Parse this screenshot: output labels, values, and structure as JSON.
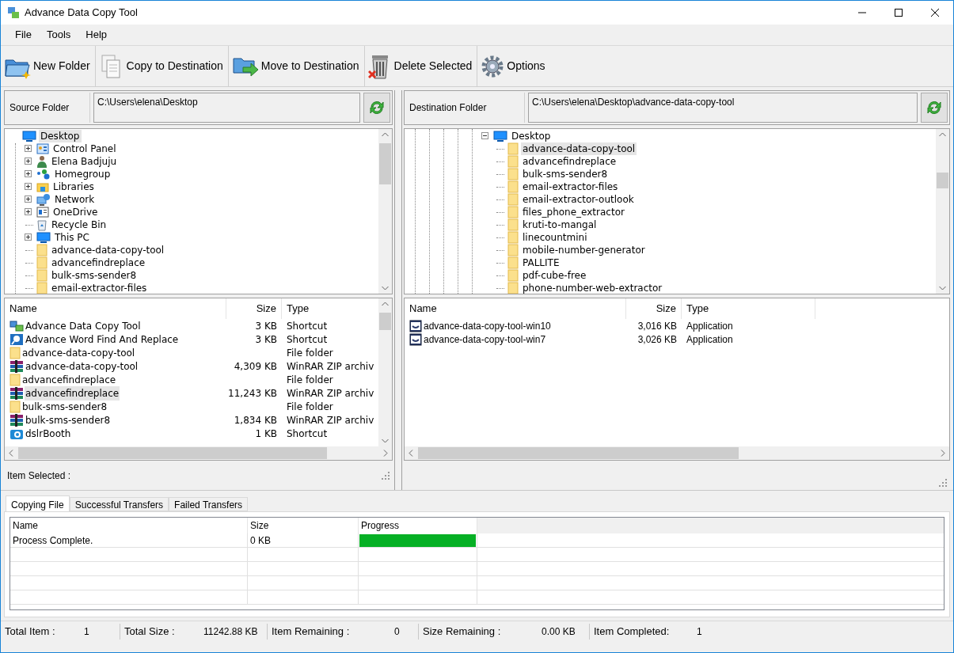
{
  "window": {
    "title": "Advance Data Copy Tool"
  },
  "menu": [
    "File",
    "Tools",
    "Help"
  ],
  "toolbar": [
    {
      "label": "New Folder",
      "kind": "newfolder",
      "disabled": false
    },
    {
      "label": "Copy to Destination",
      "kind": "copy",
      "disabled": false
    },
    {
      "label": "Move to Destination",
      "kind": "move",
      "disabled": false
    },
    {
      "label": "Delete Selected",
      "kind": "delete",
      "disabled": false
    },
    {
      "label": "Options",
      "kind": "gear",
      "disabled": false
    }
  ],
  "source": {
    "label": "Source Folder",
    "path": "C:\\Users\\elena\\Desktop",
    "tree": [
      {
        "label": "Desktop",
        "kind": "desktop",
        "expandable": false,
        "selected": true,
        "children": [
          {
            "label": "Control Panel",
            "kind": "panel",
            "expandable": true,
            "expanded": false,
            "selected": false
          },
          {
            "label": "Elena Badjuju",
            "kind": "user",
            "expandable": true,
            "expanded": false,
            "selected": false
          },
          {
            "label": "Homegroup",
            "kind": "homegroup",
            "expandable": true,
            "expanded": false,
            "selected": false
          },
          {
            "label": "Libraries",
            "kind": "libraries",
            "expandable": true,
            "expanded": false,
            "selected": false
          },
          {
            "label": "Network",
            "kind": "network",
            "expandable": true,
            "expanded": false,
            "selected": false
          },
          {
            "label": "OneDrive",
            "kind": "onedrive",
            "expandable": true,
            "expanded": false,
            "selected": false
          },
          {
            "label": "Recycle Bin",
            "kind": "recycle",
            "expandable": false,
            "selected": false
          },
          {
            "label": "This PC",
            "kind": "desktop",
            "expandable": true,
            "expanded": false,
            "selected": false
          },
          {
            "label": "advance-data-copy-tool",
            "kind": "folder",
            "expandable": false,
            "selected": false
          },
          {
            "label": "advancefindreplace",
            "kind": "folder",
            "expandable": false,
            "selected": false
          },
          {
            "label": "bulk-sms-sender8",
            "kind": "folder",
            "expandable": false,
            "selected": false
          },
          {
            "label": "email-extractor-files",
            "kind": "folder",
            "expandable": false,
            "selected": false
          }
        ]
      }
    ],
    "columns": [
      "Name",
      "Size",
      "Type"
    ],
    "files": [
      {
        "name": "Advance Data Copy Tool",
        "size": "3 KB",
        "type": "Shortcut",
        "kind": "copytool",
        "selected": false
      },
      {
        "name": "Advance Word Find And Replace",
        "size": "3 KB",
        "type": "Shortcut",
        "kind": "wordapp",
        "selected": false
      },
      {
        "name": "advance-data-copy-tool",
        "type": "File folder",
        "kind": "folder",
        "selected": false
      },
      {
        "name": "advance-data-copy-tool",
        "size": "4,309 KB",
        "type": "WinRAR ZIP archiv",
        "kind": "archive",
        "selected": false
      },
      {
        "name": "advancefindreplace",
        "type": "File folder",
        "kind": "folder",
        "selected": false
      },
      {
        "name": "advancefindreplace",
        "size": "11,243 KB",
        "type": "WinRAR ZIP archiv",
        "kind": "archive",
        "selected": true
      },
      {
        "name": "bulk-sms-sender8",
        "type": "File folder",
        "kind": "folder",
        "selected": false
      },
      {
        "name": "bulk-sms-sender8",
        "size": "1,834 KB",
        "type": "WinRAR ZIP archiv",
        "kind": "archive",
        "selected": false
      },
      {
        "name": "dslrBooth",
        "size": "1 KB",
        "type": "Shortcut",
        "kind": "camera",
        "selected": false
      }
    ],
    "status": "Item Selected :"
  },
  "destination": {
    "label": "Destination Folder",
    "path": "C:\\Users\\elena\\Desktop\\advance-data-copy-tool",
    "tree": [
      {
        "label": "Desktop",
        "kind": "desktop",
        "expandable": true,
        "expanded": true,
        "selected": false,
        "children": [
          {
            "label": "advance-data-copy-tool",
            "kind": "folder",
            "expandable": false,
            "selected": true
          },
          {
            "label": "advancefindreplace",
            "kind": "folder",
            "expandable": false,
            "selected": false
          },
          {
            "label": "bulk-sms-sender8",
            "kind": "folder",
            "expandable": false,
            "selected": false
          },
          {
            "label": "email-extractor-files",
            "kind": "folder",
            "expandable": false,
            "selected": false
          },
          {
            "label": "email-extractor-outlook",
            "kind": "folder",
            "expandable": false,
            "selected": false
          },
          {
            "label": "files_phone_extractor",
            "kind": "folder",
            "expandable": false,
            "selected": false
          },
          {
            "label": "kruti-to-mangal",
            "kind": "folder",
            "expandable": false,
            "selected": false
          },
          {
            "label": "linecountmini",
            "kind": "folder",
            "expandable": false,
            "selected": false
          },
          {
            "label": "mobile-number-generator",
            "kind": "folder",
            "expandable": false,
            "selected": false
          },
          {
            "label": "PALLITE",
            "kind": "folder",
            "expandable": false,
            "selected": false
          },
          {
            "label": "pdf-cube-free",
            "kind": "folder",
            "expandable": false,
            "selected": false
          },
          {
            "label": "phone-number-web-extractor",
            "kind": "folder",
            "expandable": false,
            "selected": false
          }
        ]
      }
    ],
    "columns": [
      "Name",
      "Size",
      "Type"
    ],
    "files": [
      {
        "name": "advance-data-copy-tool-win10",
        "size": "3,016 KB",
        "type": "Application",
        "kind": "exe",
        "selected": false
      },
      {
        "name": "advance-data-copy-tool-win7",
        "size": "3,026 KB",
        "type": "Application",
        "kind": "exe",
        "selected": false
      }
    ]
  },
  "transfer_tabs": [
    {
      "label": "Copying File",
      "selected": true
    },
    {
      "label": "Successful Transfers",
      "selected": false
    },
    {
      "label": "Failed Transfers",
      "selected": false
    }
  ],
  "transfer_table": {
    "columns": [
      "Name",
      "Size",
      "Progress"
    ],
    "rows": [
      {
        "name": "Process Complete.",
        "size": "0 KB",
        "level": 1
      }
    ]
  },
  "status_bar": [
    {
      "label": "Total Item :",
      "value": "1"
    },
    {
      "label": "Total Size :",
      "value": "11242.88 KB"
    },
    {
      "label": "Item Remaining :",
      "value": "0"
    },
    {
      "label": "Size Remaining :",
      "value": "0.00 KB"
    },
    {
      "label": "Item Completed:",
      "value": "1"
    }
  ]
}
